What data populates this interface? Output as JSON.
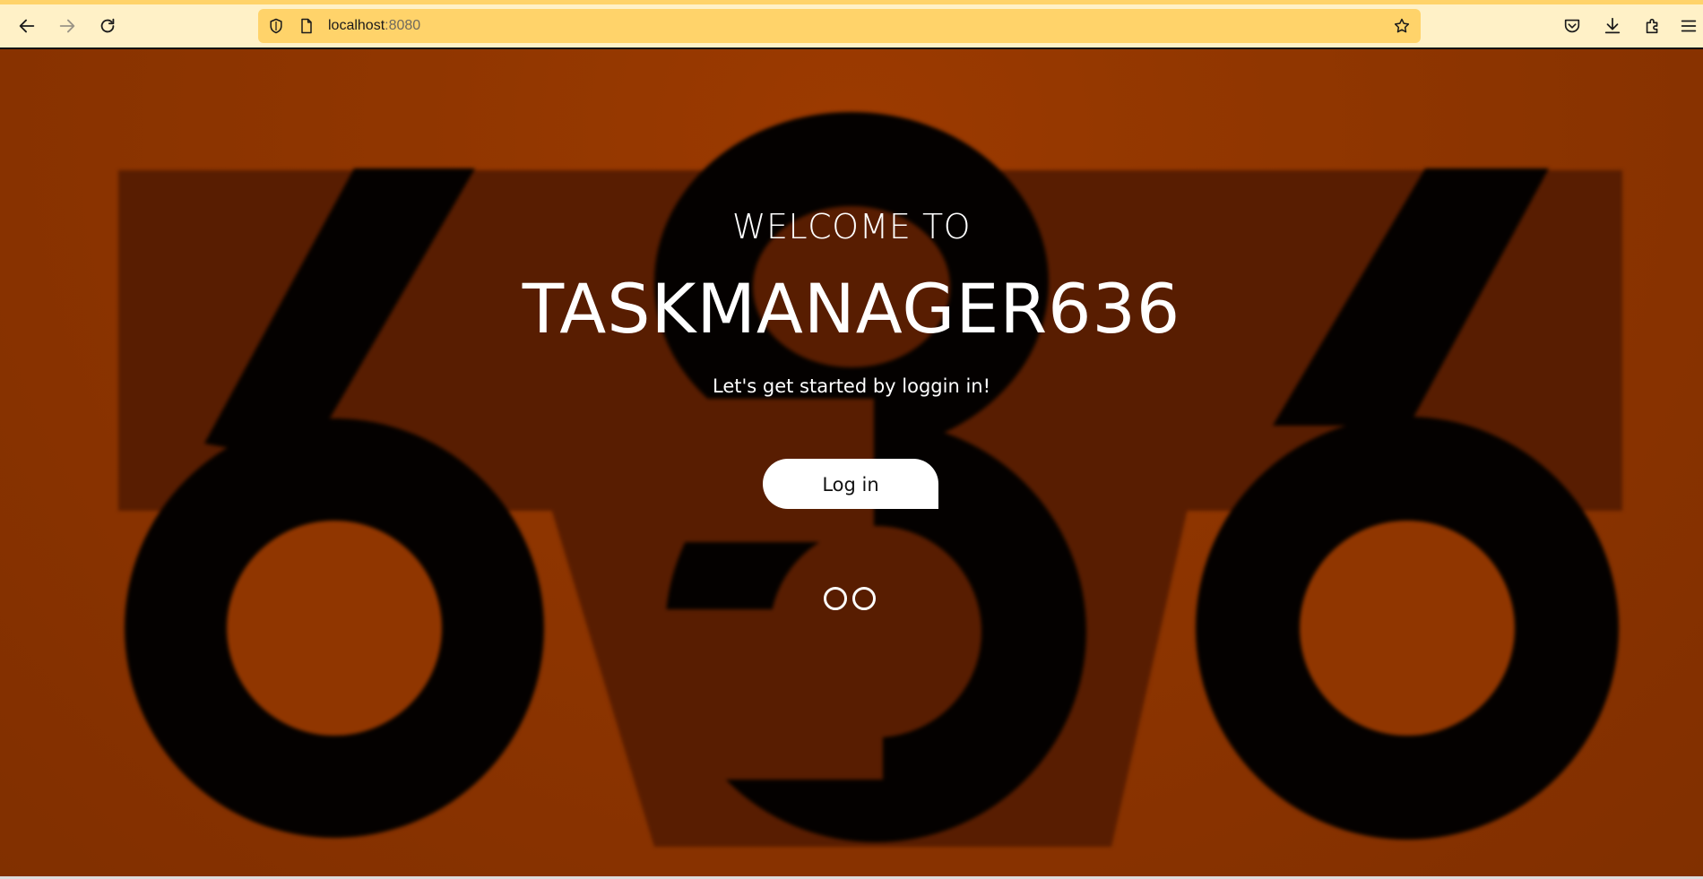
{
  "browser": {
    "url_host": "localhost",
    "url_port": ":8080",
    "toolbar_color": "#fff1c7",
    "urlbar_color": "#ffd36a",
    "icons": {
      "back": "arrow-left-icon",
      "forward": "arrow-right-icon",
      "reload": "reload-icon",
      "shield": "shield-icon",
      "page": "page-icon",
      "bookmark": "star-icon",
      "pocket": "pocket-icon",
      "downloads": "download-icon",
      "extensions": "puzzle-icon",
      "menu": "hamburger-menu-icon"
    }
  },
  "hero": {
    "welcome": "WELCOME TO",
    "app_name": "TASKMANAGER636",
    "subtitle": "Let's get started by loggin in!",
    "login_label": "Log in",
    "slide_count": 2,
    "background_text": "636",
    "accent_color": "#9a3a00"
  }
}
